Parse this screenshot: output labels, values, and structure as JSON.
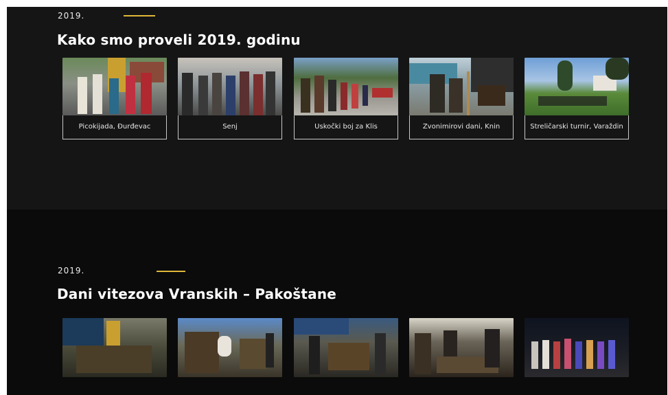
{
  "section1": {
    "year": "2019.",
    "title": "Kako smo proveli 2019. godinu",
    "cards": [
      {
        "caption": "Picokijada, Đurđevac"
      },
      {
        "caption": "Senj"
      },
      {
        "caption": "Uskočki boj za Klis"
      },
      {
        "caption": "Zvonimirovi dani, Knin"
      },
      {
        "caption": "Streličarski turnir, Varaždin"
      }
    ]
  },
  "section2": {
    "year": "2019.",
    "title": "Dani vitezova Vranskih – Pakoštane",
    "photos": 5
  },
  "colors": {
    "accent": "#e0b83a",
    "section1_bg": "#151515",
    "section2_bg": "#0b0b0b"
  }
}
